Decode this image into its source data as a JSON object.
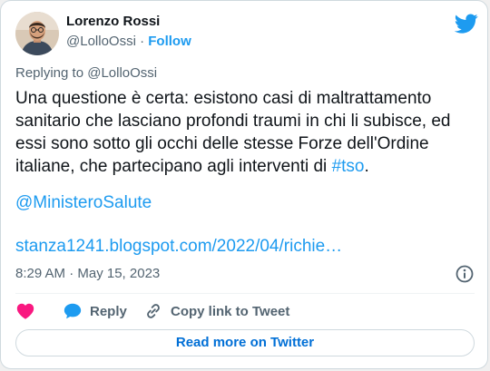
{
  "author": {
    "name": "Lorenzo Rossi",
    "handle": "@LolloOssi",
    "separator": "·",
    "follow_label": "Follow"
  },
  "reply_context": "Replying to @LolloOssi",
  "tweet": {
    "text": "Una questione è certa: esistono casi di maltrattamento sanitario che lasciano profondi traumi in chi li subisce, ed essi sono sotto gli occhi delle stesse Forze dell'Ordine italiane, che partecipano agli interventi di ",
    "hashtag": "#tso",
    "text_end": ".",
    "mention": "@MinisteroSalute",
    "url": "stanza1241.blogspot.com/2022/04/richie…"
  },
  "timestamp": "8:29 AM · May 15, 2023",
  "actions": {
    "like_label": "",
    "reply_label": "Reply",
    "copy_label": "Copy link to Tweet"
  },
  "read_more_label": "Read more on Twitter",
  "colors": {
    "accent": "#1d9bf0",
    "like": "#f91880",
    "text": "#0f1419",
    "muted": "#536471"
  },
  "icons": {
    "brand": "twitter-bird-icon",
    "info": "info-icon",
    "like": "heart-icon",
    "reply": "speech-bubble-icon",
    "copy": "link-icon"
  }
}
